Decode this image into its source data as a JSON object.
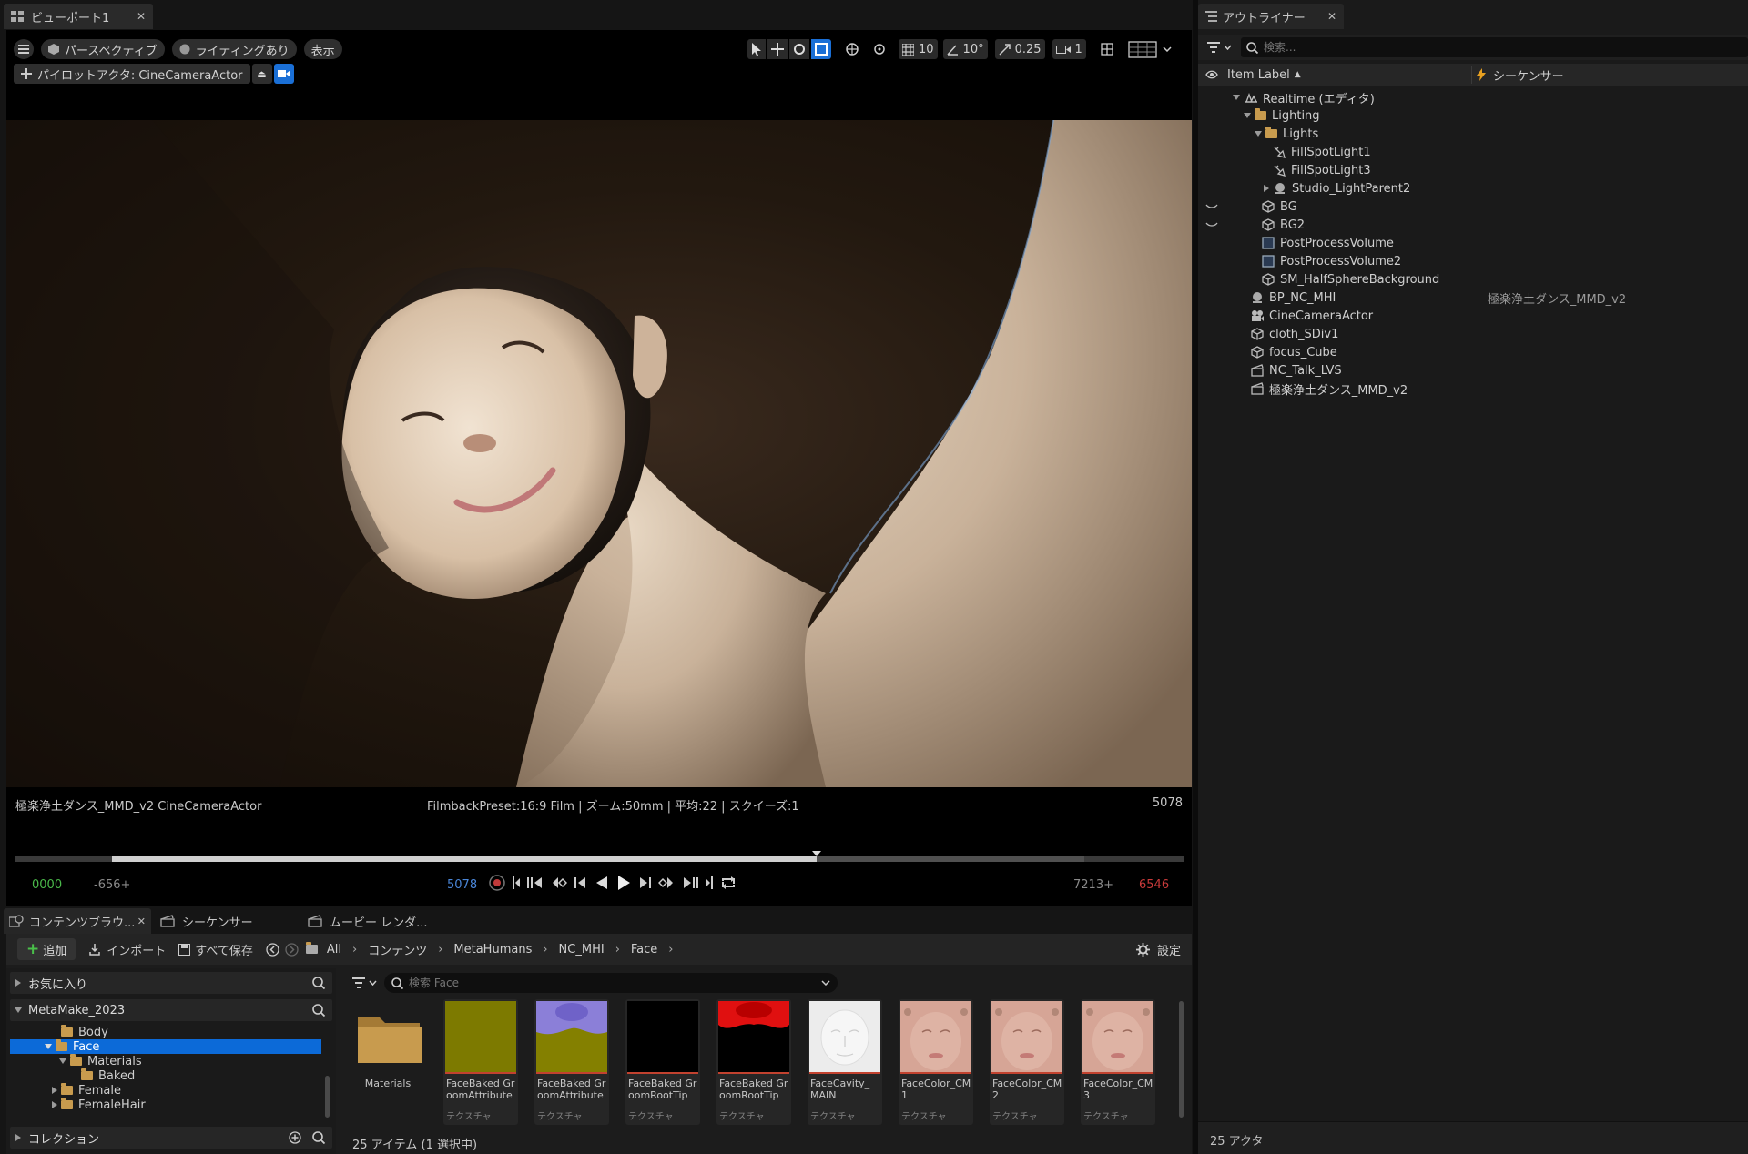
{
  "viewport": {
    "tab_title": "ビューポート1",
    "perspective_label": "パースペクティブ",
    "lighting_label": "ライティングあり",
    "show_label": "表示",
    "pilot_label": "パイロットアクタ: CineCameraActor",
    "toolbar": {
      "grid": "10",
      "angle": "10°",
      "scale": "0.25",
      "camera_speed": "1"
    },
    "cam_info_left": "極楽浄土ダンス_MMD_v2 CineCameraActor",
    "cam_info_center": "FilmbackPreset:16:9 Film | ズーム:50mm | 平均:22 | スクイーズ:1",
    "cam_info_right": "5078"
  },
  "timeline": {
    "start": "0000",
    "lower_bound": "-656+",
    "current": "5078",
    "upper_bound": "7213+",
    "end": "6546",
    "playhead_fraction": 0.725
  },
  "outliner": {
    "tab_title": "アウトライナー",
    "search_placeholder": "検索...",
    "col_item_label": "Item Label",
    "col_sequencer": "シーケンサー",
    "rows": [
      {
        "label": "Realtime (エディタ)",
        "seq": ""
      },
      {
        "label": "Lighting",
        "seq": ""
      },
      {
        "label": "Lights",
        "seq": ""
      },
      {
        "label": "FillSpotLight1",
        "seq": ""
      },
      {
        "label": "FillSpotLight3",
        "seq": ""
      },
      {
        "label": "Studio_LightParent2",
        "seq": ""
      },
      {
        "label": "BG",
        "seq": ""
      },
      {
        "label": "BG2",
        "seq": ""
      },
      {
        "label": "PostProcessVolume",
        "seq": ""
      },
      {
        "label": "PostProcessVolume2",
        "seq": ""
      },
      {
        "label": "SM_HalfSphereBackground",
        "seq": ""
      },
      {
        "label": "BP_NC_MHI",
        "seq": "極楽浄土ダンス_MMD_v2"
      },
      {
        "label": "CineCameraActor",
        "seq": ""
      },
      {
        "label": "cloth_SDiv1",
        "seq": ""
      },
      {
        "label": "focus_Cube",
        "seq": ""
      },
      {
        "label": "NC_Talk_LVS",
        "seq": ""
      },
      {
        "label": "極楽浄土ダンス_MMD_v2",
        "seq": ""
      }
    ],
    "footer": "25 アクタ"
  },
  "bottom_tabs": {
    "content_browser": "コンテンツブラウ...",
    "sequencer": "シーケンサー",
    "movie_render": "ムービー レンダ..."
  },
  "content_browser": {
    "add_label": "追加",
    "import_label": "インポート",
    "save_all_label": "すべて保存",
    "settings_label": "設定",
    "breadcrumb": [
      "All",
      "コンテンツ",
      "MetaHumans",
      "NC_MHI",
      "Face"
    ],
    "favorites_label": "お気に入り",
    "project_label": "MetaMake_2023",
    "tree": [
      "Body",
      "Face",
      "Materials",
      "Baked",
      "Female",
      "FemaleHair"
    ],
    "collections_label": "コレクション",
    "search_placeholder": "検索 Face",
    "status": "25 アイテム (1 選択中)",
    "assets": [
      {
        "name": "Materials",
        "type": "",
        "color": "#c89b4e"
      },
      {
        "name": "FaceBaked GroomAttribute",
        "type": "テクスチャ",
        "color": "#7d7a00"
      },
      {
        "name": "FaceBaked GroomAttribute",
        "type": "テクスチャ",
        "color": "#848000"
      },
      {
        "name": "FaceBaked GroomRootTip",
        "type": "テクスチャ",
        "color": "#000000"
      },
      {
        "name": "FaceBaked GroomRootTip",
        "type": "テクスチャ",
        "color": "#000000"
      },
      {
        "name": "FaceCavity_ MAIN",
        "type": "テクスチャ",
        "color": "#e8e8e8"
      },
      {
        "name": "FaceColor_CM1",
        "type": "テクスチャ",
        "color": "#d6a596"
      },
      {
        "name": "FaceColor_CM2",
        "type": "テクスチャ",
        "color": "#d6a596"
      },
      {
        "name": "FaceColor_CM3",
        "type": "テクスチャ",
        "color": "#d6a596"
      }
    ]
  }
}
